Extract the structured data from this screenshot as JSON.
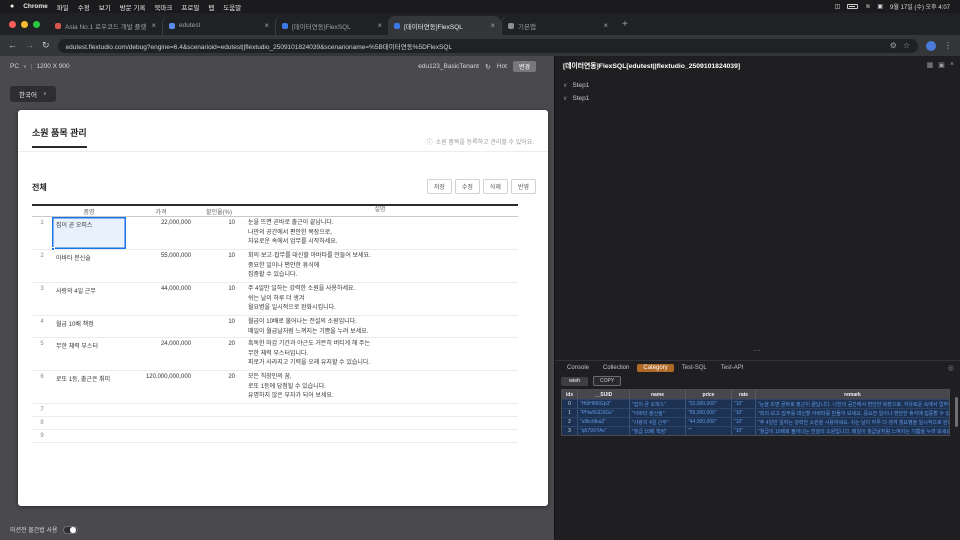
{
  "colors": {
    "accent_blue": "#1a73e8",
    "category_orange": "#b06a28",
    "console_text_blue": "#5f9ae8",
    "selected_row_bg": "#1d3152"
  },
  "icons": {
    "chevron": "∨",
    "info": "ⓘ",
    "refresh": "↻",
    "back": "←",
    "forward": "→",
    "star": "☆",
    "kebab": "⋮",
    "plus": "+",
    "close": "×",
    "pin": "◎",
    "grid": "▦",
    "panel": "▣",
    "dots": "⋯",
    "gear": "⚙",
    "wifi": "≋",
    "display": "◫",
    "apple": "●",
    "sep": "|"
  },
  "menubar": {
    "items": [
      "Chrome",
      "파일",
      "수정",
      "보기",
      "방문 기록",
      "북마크",
      "프로필",
      "탭",
      "도움말"
    ],
    "clock": "9월 17일 (수) 오후 4:07"
  },
  "browser": {
    "tabs": [
      {
        "label": "Asia No.1 로우코드 개발 플랫폼 |"
      },
      {
        "label": "edutest"
      },
      {
        "label": "[데이터연동]FlexSQL"
      },
      {
        "label": "[데이터연동]FlexSQL"
      },
      {
        "label": "기본앱"
      }
    ],
    "url": "edutest.flextudio.com/debug?engine=6.4&scenarioid=edutest||flextudio_2509101824039&scenarioname=%5B데이터연동%5DFlexSQL"
  },
  "preview": {
    "device": "PC",
    "resolution": "1200 X 900",
    "tenant": "edu123_BasicTenant",
    "hot": "Hot",
    "change": "변경",
    "language": "한국어",
    "footer_toggle": "미션전 몰간법 사용",
    "app": {
      "title": "소원 품목 관리",
      "hint": "소원 품목을 등록하고 관리할 수 있어요.",
      "section": "전체",
      "buttons": [
        "저장",
        "수정",
        "삭제",
        "반영"
      ],
      "table": {
        "headers": [
          "품명",
          "가격",
          "할인율(%)",
          "설명"
        ],
        "rows": [
          {
            "no": "1",
            "name": "집이 곧 오피스",
            "price": "22,000,000",
            "rate": "10",
            "desc": "눈을 뜨면 곧바로 출근이 끝납니다.\n나만의 공간에서 편안한 복장으로,\n자유로운 속에서 업무를 시작하세요."
          },
          {
            "no": "2",
            "name": "아바타 분신술",
            "price": "55,000,000",
            "rate": "10",
            "desc": "회의·보고·잡무를 대신할 아바타를 만들어 보세요.\n중요한 일이나 편안한 휴식에\n집중할 수 있습니다."
          },
          {
            "no": "3",
            "name": "사랑의 4일 근무",
            "price": "44,000,000",
            "rate": "10",
            "desc": "주 4일만 일하는 강력한 소원을 사용하세요.\n쉬는 날이 하루 더 생겨\n월요병을 일시적으로 완화시킵니다."
          },
          {
            "no": "4",
            "name": "월급 10배 책정",
            "price": "",
            "rate": "10",
            "desc": "월급이 10배로 불어나는 전설의 소원입니다.\n매일이 월급날처럼 느껴지는 기쁨을 누려 보세요."
          },
          {
            "no": "5",
            "name": "무한 체력 부스터",
            "price": "24,000,000",
            "rate": "20",
            "desc": "혹독한 마감 기간과 야근도 거뜬히 버티게 해 주는\n무한 체력 부스터입니다.\n피로가 사라지고 기력을 오래 유지할 수 있습니다."
          },
          {
            "no": "6",
            "name": "로또 1등, 출근은 취미",
            "price": "120,000,000,000",
            "rate": "20",
            "desc": "모든 직장인의 꿈,\n로또 1등에 당첨될 수 있습니다.\n유명하지 않은 부자가 되어 보세요."
          },
          {
            "no": "7",
            "name": "",
            "price": "",
            "rate": "",
            "desc": ""
          },
          {
            "no": "8",
            "name": "",
            "price": "",
            "rate": "",
            "desc": ""
          },
          {
            "no": "9",
            "name": "",
            "price": "",
            "rate": "",
            "desc": ""
          }
        ]
      }
    }
  },
  "inspector": {
    "title": "[데이터연동]FlexSQL[edutest||flextudio_2509101824039]",
    "steps": [
      "Step1",
      "Step1"
    ],
    "console": {
      "tabs": [
        "Console",
        "Collection",
        "Category",
        "Test-SQL",
        "Test-API"
      ],
      "active_tab": "Category",
      "collection": "wish",
      "copy": "COPY",
      "table": {
        "headers": [
          "idx",
          "__SUID",
          "name",
          "price",
          "rate",
          "remark"
        ],
        "rows": [
          {
            "idx": "0",
            "suid": "\"H0iHt90Gp3\"",
            "name": "\"집이 곧 오피스\"",
            "price": "\"22,000,000\"",
            "rate": "\"10\"",
            "remark": "\"눈을 뜨면 곧바로 출근이 끝납니다. 나만의 공간에서 편안한 복장으로, 자유로운 속에서 업무를 시작하세요.\""
          },
          {
            "idx": "1",
            "suid": "\"PHw5GD2Gs\"",
            "name": "\"아바타 분신술\"",
            "price": "\"55,000,000\"",
            "rate": "\"10\"",
            "remark": "\"회의·보고·잡무를 대신할 아바타를 만들어 보세요. 중요한 일이나 편안한 휴식에 집중할 수 있습니다.\""
          },
          {
            "idx": "2",
            "suid": "\"s9kct9ka2\"",
            "name": "\"사랑의 4일 근무\"",
            "price": "\"44,000,000\"",
            "rate": "\"10\"",
            "remark": "\"주 4일만 일하는 강력한 소원을 사용하세요. 쉬는 날이 하루 더 생겨 월요병을 일시적으로 완화시킵니다.\""
          },
          {
            "idx": "3",
            "suid": "\"q579XYAc\"",
            "name": "\"월급 10배 책정\"",
            "price": "\"\"",
            "rate": "\"10\"",
            "remark": "\"월급이 10배로 불어나는 전설의 소원입니다. 매일이 월급날처럼 느껴지는 기쁨을 누려 보세요.\""
          }
        ]
      }
    }
  }
}
